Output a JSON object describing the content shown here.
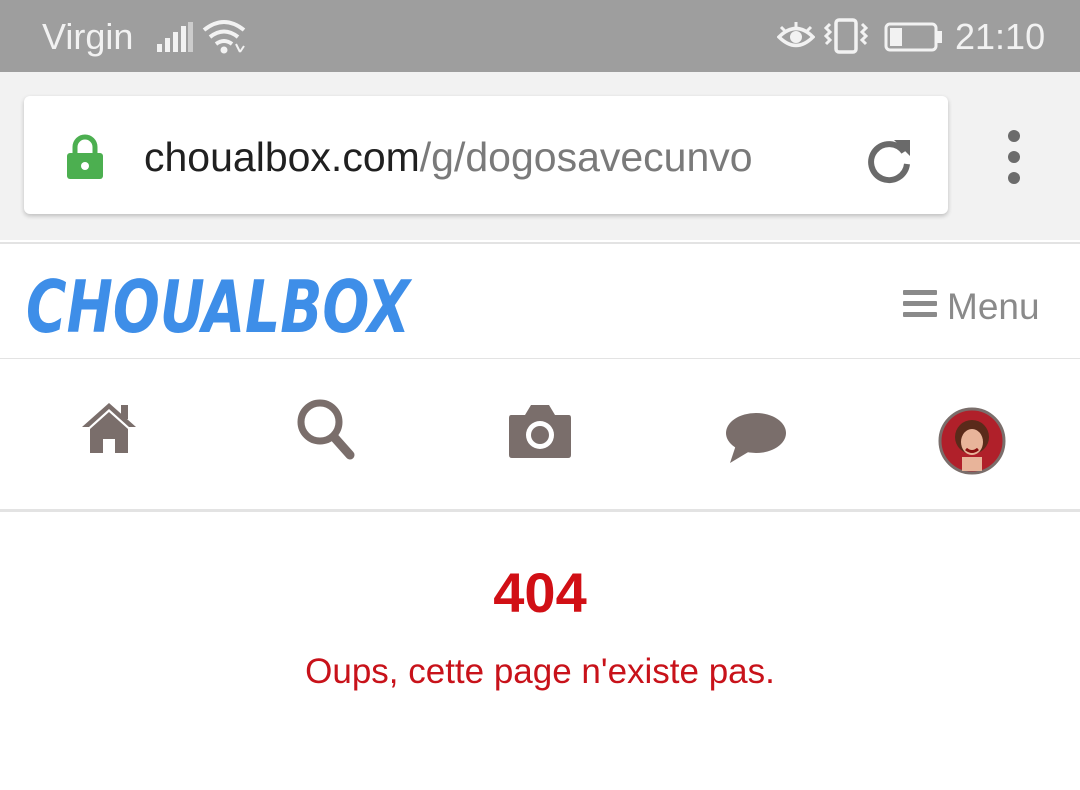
{
  "status_bar": {
    "carrier": "Virgin",
    "time": "21:10",
    "icons": [
      "signal-icon",
      "wifi-icon",
      "eye-icon",
      "vibrate-icon",
      "battery-icon"
    ]
  },
  "browser": {
    "url_host": "choualbox.com",
    "url_path": "/g/dogosavecunvo",
    "secure": true,
    "lock_color": "#4caf50"
  },
  "site": {
    "logo_text": "CHOUALBOX",
    "logo_color": "#3e8ee8",
    "menu_label": "Menu",
    "nav_icons": [
      "home-icon",
      "search-icon",
      "camera-icon",
      "comment-icon",
      "avatar"
    ]
  },
  "error": {
    "code": "404",
    "message": "Oups, cette page n'existe pas.",
    "color": "#d10f15"
  }
}
